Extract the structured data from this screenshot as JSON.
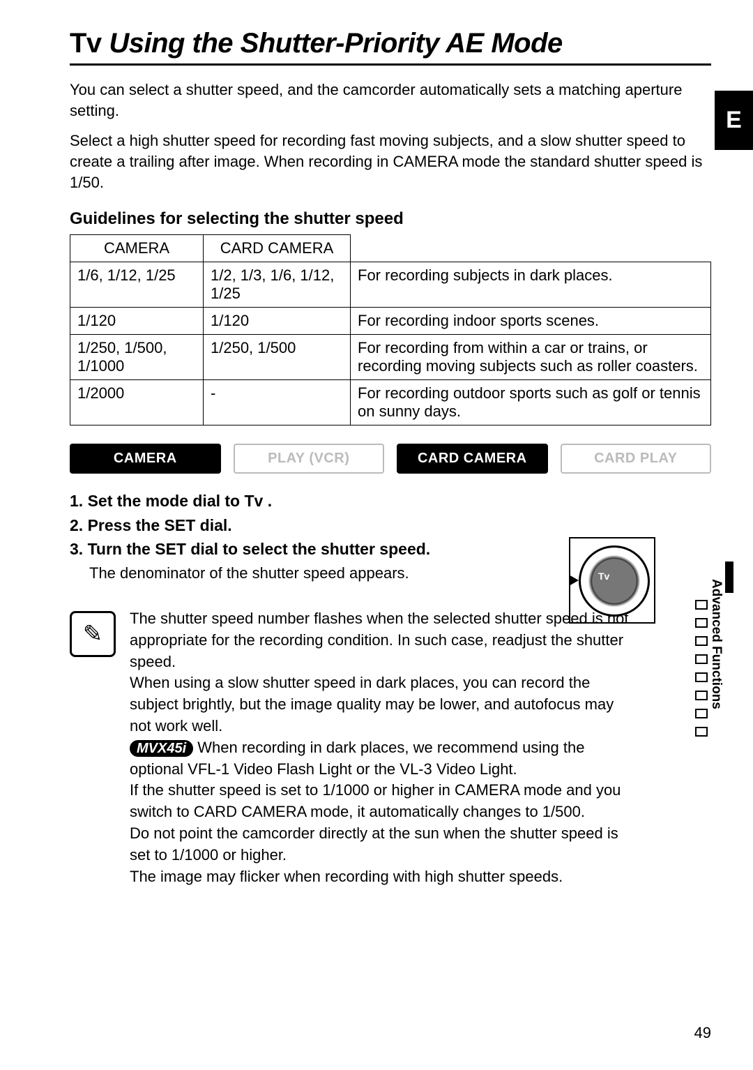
{
  "title_prefix": "Tv",
  "title_main": "Using the Shutter-Priority AE Mode",
  "lang_tab": "E",
  "intro1": "You can select a shutter speed, and the camcorder automatically sets a matching aperture setting.",
  "intro2": "Select a high shutter speed for recording fast moving subjects, and a slow shutter speed to create a trailing after image. When recording in CAMERA mode the standard shutter speed is 1/50.",
  "guidelines_heading": "Guidelines for selecting the shutter speed",
  "table": {
    "headers": [
      "CAMERA",
      "CARD CAMERA",
      ""
    ],
    "rows": [
      {
        "camera": "1/6, 1/12, 1/25",
        "card": "1/2, 1/3, 1/6, 1/12, 1/25",
        "desc": "For recording subjects in dark places."
      },
      {
        "camera": "1/120",
        "card": "1/120",
        "desc": "For recording indoor sports scenes."
      },
      {
        "camera": "1/250, 1/500, 1/1000",
        "card": "1/250, 1/500",
        "desc": "For recording from within a car or trains, or recording moving subjects such as roller coasters."
      },
      {
        "camera": "1/2000",
        "card": "-",
        "desc": "For recording outdoor sports such as golf or tennis on sunny days."
      }
    ]
  },
  "pills": {
    "camera": "CAMERA",
    "play": "PLAY (VCR)",
    "card_camera": "CARD CAMERA",
    "card_play": "CARD PLAY"
  },
  "steps": {
    "s1": "1.  Set the mode dial to Tv .",
    "s2": "2.  Press the SET dial.",
    "s3": "3.  Turn the SET dial to select the shutter speed.",
    "s3_sub": "The denominator of the shutter speed appears."
  },
  "dial_label": "Tv",
  "note_icon": "✎",
  "notes": {
    "n1": "The shutter speed number flashes when the selected shutter speed is not appropriate for the recording condition. In such case, readjust the shutter speed.",
    "n2": "When using a slow shutter speed in dark places, you can record the subject brightly, but the image quality may be lower, and autofocus may not work well.",
    "model": "MVX45i",
    "n3": " When recording in dark places, we recommend using the optional VFL-1 Video Flash Light or the VL-3 Video Light.",
    "n4": "If the shutter speed is set to 1/1000 or higher in CAMERA mode and you switch to CARD CAMERA mode, it automatically changes to 1/500.",
    "n5": "Do not point the camcorder directly at the sun when the shutter speed is set to 1/1000 or higher.",
    "n6": "The image may flicker when recording with high shutter speeds."
  },
  "side_label": "Advanced Functions",
  "page_number": "49"
}
